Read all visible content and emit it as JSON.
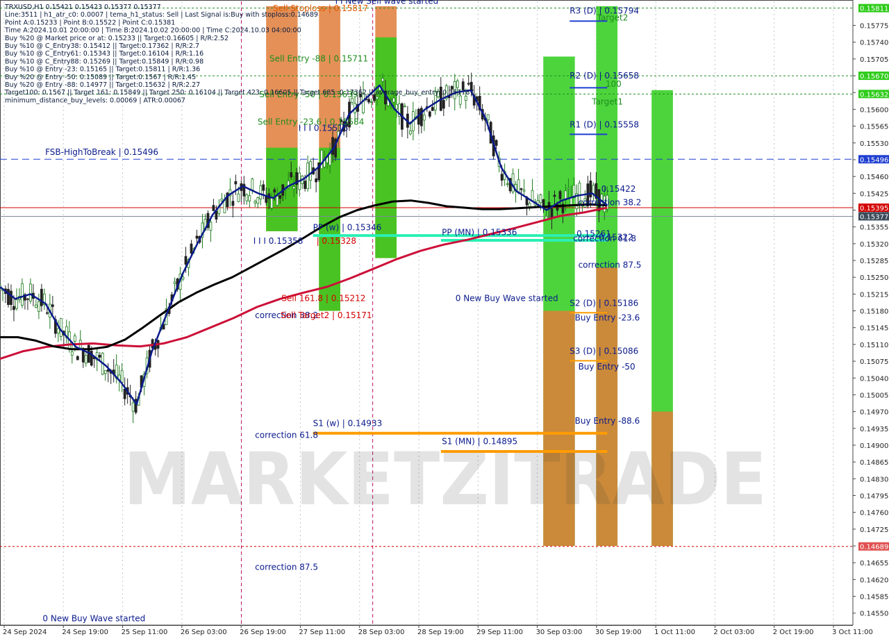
{
  "header_lines": [
    "TRXUSD,H1  0.15421 0.15423 0.15377 0.15377",
    "Line:3511 | h1_atr_c0: 0.0007 | tema_h1_status: Sell | Last Signal is:Buy with stoploss:0.14689",
    "Point A:0.15233 | Point B:0.15522 | Point C:0.15381",
    "Time A:2024.10.01 20:00:00 | Time B:2024.10.02 20:00:00 | Time C:2024.10.03 04:00:00",
    "Buy %20 @ Market price or at: 0.15233 || Target:0.16605 | R/R:2.52",
    "Buy %10 @ C_Entry38: 0.15412 || Target:0.17362 | R/R:2.7",
    "Buy %10 @ C_Entry61: 0.15343 || Target:0.16104 | R/R:1.16",
    "Buy %10 @ C_Entry88: 0.15269 || Target:0.15849 | R/R:0.98",
    "Buy %10 @ Entry -23: 0.15165 || Target:0.15811 | R/R:1.36",
    "Buy %20 @ Entry -50: 0.15089 || Target:0.1567 | R/R:1.45",
    "Buy %20 @ Entry -88: 0.14977 || Target:0.15632 | R/R:2.27",
    "Target100: 0.1567 || Target 161: 0.15849 || Target 250: 0.16104 || Target 423: 0.16605 || Target 685: 0.17362 || average_buy_entry: 0.151787",
    "minimum_distance_buy_levels: 0.00069 | ATR:0.00067"
  ],
  "watermark": "MARKETZITRADE",
  "colors": {
    "background": "#ffffff",
    "grid": "#d8dde4",
    "bull_candle": "#1e7a1e",
    "bear_candle": "#222222",
    "price_axis_text": "#222222",
    "green_zone": "#2ecc1a",
    "orange_zone": "#e07d3a",
    "level_line": "#ff9c00",
    "pivot_line": "#2af0b4",
    "ma_fast": "#0a1a8c",
    "ma_slow": "#000000",
    "ma_mid": "#cc1038",
    "label_blue": "#0a1a8c",
    "accent_red": "#d40000"
  },
  "chart_data": {
    "type": "candlestick",
    "symbol": "TRXUSD",
    "timeframe": "H1",
    "ylim": [
      0.14525,
      0.15825
    ],
    "y_ticks": [
      "0.15775",
      "0.15740",
      "0.15705",
      "0.15670",
      "0.15635",
      "0.15600",
      "0.15565",
      "0.15530",
      "0.15495",
      "0.15460",
      "0.15425",
      "0.15390",
      "0.15355",
      "0.15320",
      "0.15285",
      "0.15250",
      "0.15215",
      "0.15180",
      "0.15145",
      "0.15110",
      "0.15075",
      "0.15040",
      "0.15005",
      "0.14970",
      "0.14935",
      "0.14900",
      "0.14865",
      "0.14830",
      "0.14795",
      "0.14760",
      "0.14725",
      "0.14690",
      "0.14655",
      "0.14620",
      "0.14585",
      "0.14550"
    ],
    "x_labels": [
      "24 Sep 2024",
      "24 Sep 19:00",
      "25 Sep 11:00",
      "26 Sep 03:00",
      "26 Sep 19:00",
      "27 Sep 11:00",
      "28 Sep 03:00",
      "28 Sep 19:00",
      "29 Sep 11:00",
      "30 Sep 03:00",
      "30 Sep 19:00",
      "1 Oct 11:00",
      "2 Oct 03:00",
      "2 Oct 19:00",
      "3 Oct 11:00"
    ],
    "price_tags": [
      {
        "value": 0.15811,
        "text": "0.15811",
        "color": "#2ecc1a"
      },
      {
        "value": 0.1567,
        "text": "0.15670",
        "color": "#2ecc1a"
      },
      {
        "value": 0.15632,
        "text": "0.15632",
        "color": "#2ecc1a"
      },
      {
        "value": 0.15496,
        "text": "0.15496",
        "color": "#1f3fd1"
      },
      {
        "value": 0.15395,
        "text": "0.15395",
        "color": "#d40000"
      },
      {
        "value": 0.15377,
        "text": "0.15377",
        "color": "#3a4a5a"
      },
      {
        "value": 0.14689,
        "text": "0.14689",
        "color": "#e05050"
      }
    ],
    "horizontal_lines": [
      {
        "value": 0.15811,
        "color": "#1e8c1e",
        "dash": "3,3"
      },
      {
        "value": 0.1567,
        "color": "#1e8c1e",
        "dash": "3,3"
      },
      {
        "value": 0.15632,
        "color": "#1e8c1e",
        "dash": "3,3"
      },
      {
        "value": 0.15496,
        "color": "#1f3fd1",
        "dash": "10,6"
      },
      {
        "value": 0.15395,
        "color": "#d40000",
        "dash": ""
      },
      {
        "value": 0.15377,
        "color": "#7a8a9a",
        "dash": ""
      },
      {
        "value": 0.14689,
        "color": "#d40000",
        "dash": "3,3"
      }
    ],
    "zones": [
      {
        "x_from": 0.312,
        "x_to": 0.349,
        "y_from": 0.15815,
        "y_to": 0.15346,
        "color": "#e07d3a"
      },
      {
        "x_from": 0.312,
        "x_to": 0.349,
        "y_from": 0.1552,
        "y_to": 0.15346,
        "color": "#2ecc1a"
      },
      {
        "x_from": 0.374,
        "x_to": 0.399,
        "y_from": 0.15815,
        "y_to": 0.1518,
        "color": "#e07d3a"
      },
      {
        "x_from": 0.374,
        "x_to": 0.399,
        "y_from": 0.1552,
        "y_to": 0.1518,
        "color": "#2ecc1a"
      },
      {
        "x_from": 0.44,
        "x_to": 0.465,
        "y_from": 0.15815,
        "y_to": 0.1529,
        "color": "#e07d3a"
      },
      {
        "x_from": 0.44,
        "x_to": 0.465,
        "y_from": 0.1575,
        "y_to": 0.1529,
        "color": "#2ecc1a"
      },
      {
        "x_from": 0.637,
        "x_to": 0.674,
        "y_from": 0.1571,
        "y_to": 0.1469,
        "color": "#2ecc1a"
      },
      {
        "x_from": 0.637,
        "x_to": 0.674,
        "y_from": 0.1518,
        "y_to": 0.1469,
        "color": "#e07d3a"
      },
      {
        "x_from": 0.699,
        "x_to": 0.724,
        "y_from": 0.15815,
        "y_to": 0.1469,
        "color": "#2ecc1a"
      },
      {
        "x_from": 0.699,
        "x_to": 0.724,
        "y_from": 0.1527,
        "y_to": 0.1469,
        "color": "#e07d3a"
      },
      {
        "x_from": 0.764,
        "x_to": 0.789,
        "y_from": 0.1564,
        "y_to": 0.1469,
        "color": "#2ecc1a"
      },
      {
        "x_from": 0.764,
        "x_to": 0.789,
        "y_from": 0.1497,
        "y_to": 0.1469,
        "color": "#e07d3a"
      }
    ],
    "level_segments": [
      {
        "x_from": 0.367,
        "x_to": 0.712,
        "value": 0.14925,
        "color": "#ff9c00",
        "width": 4
      },
      {
        "x_from": 0.517,
        "x_to": 0.712,
        "value": 0.14887,
        "color": "#ff9c00",
        "width": 4
      },
      {
        "x_from": 0.367,
        "x_to": 0.712,
        "value": 0.15337,
        "color": "#2af0b4",
        "width": 4
      },
      {
        "x_from": 0.517,
        "x_to": 0.712,
        "value": 0.15327,
        "color": "#2af0b4",
        "width": 4
      },
      {
        "x_from": 0.668,
        "x_to": 0.712,
        "value": 0.15784,
        "color": "#1f3fd1",
        "width": 2
      },
      {
        "x_from": 0.668,
        "x_to": 0.712,
        "value": 0.15645,
        "color": "#1f3fd1",
        "width": 2
      },
      {
        "x_from": 0.668,
        "x_to": 0.712,
        "value": 0.15548,
        "color": "#1f3fd1",
        "width": 2
      },
      {
        "x_from": 0.668,
        "x_to": 0.712,
        "value": 0.15176,
        "color": "#ff9c00",
        "width": 2
      },
      {
        "x_from": 0.668,
        "x_to": 0.712,
        "value": 0.15076,
        "color": "#ff9c00",
        "width": 2
      }
    ],
    "annotations": [
      {
        "text": "FSB-HighToBreak | 0.15496",
        "x": 0.053,
        "value": 0.15505,
        "color": "#0a1a8c"
      },
      {
        "text": "Sell Stoploss | 0.15817",
        "x": 0.32,
        "value": 0.15805,
        "color": "#e05a00"
      },
      {
        "text": "I I New Sell wave started",
        "x": 0.393,
        "value": 0.1582,
        "color": "#0a1a8c"
      },
      {
        "text": "Sell Entry -88 | 0.15711",
        "x": 0.316,
        "value": 0.157,
        "color": "#1e8c1e"
      },
      {
        "text": "Sell Entry -50 | 0.15639",
        "x": 0.304,
        "value": 0.15625,
        "color": "#1e8c1e"
      },
      {
        "text": "Sell Entry -23.6 | 0.15584",
        "x": 0.302,
        "value": 0.15568,
        "color": "#1e8c1e"
      },
      {
        "text": "I I I 0.15515",
        "x": 0.35,
        "value": 0.15555,
        "color": "#0a1a8c"
      },
      {
        "text": "PP (w) | 0.15346",
        "x": 0.367,
        "value": 0.15348,
        "color": "#0a1a8c"
      },
      {
        "text": "PP (MN) | 0.15336",
        "x": 0.518,
        "value": 0.15338,
        "color": "#0a1a8c"
      },
      {
        "text": "I I I 0.15358",
        "x": 0.297,
        "value": 0.1532,
        "color": "#0a1a8c"
      },
      {
        "text": "| 0.15328",
        "x": 0.371,
        "value": 0.1532,
        "color": "#d40000"
      },
      {
        "text": "Sell 161.8 | 0.15212",
        "x": 0.33,
        "value": 0.152,
        "color": "#d40000"
      },
      {
        "text": "correction 38.2",
        "x": 0.299,
        "value": 0.15165,
        "color": "#0a1a8c"
      },
      {
        "text": "Sell Target2 | 0.15171",
        "x": 0.329,
        "value": 0.15165,
        "color": "#d40000"
      },
      {
        "text": "0 New Buy Wave started",
        "x": 0.534,
        "value": 0.152,
        "color": "#0a1a8c"
      },
      {
        "text": "R3 (D) | 0.15794",
        "x": 0.668,
        "value": 0.158,
        "color": "#0a1a8c"
      },
      {
        "text": "Target2",
        "x": 0.7,
        "value": 0.15785,
        "color": "#1e8c1e"
      },
      {
        "text": "R2 (D) | 0.15658",
        "x": 0.668,
        "value": 0.15664,
        "color": "#0a1a8c"
      },
      {
        "text": "100",
        "x": 0.71,
        "value": 0.15647,
        "color": "#1e8c1e"
      },
      {
        "text": "Target1",
        "x": 0.694,
        "value": 0.1561,
        "color": "#1e8c1e"
      },
      {
        "text": "R1 (D) | 0.15558",
        "x": 0.668,
        "value": 0.15562,
        "color": "#0a1a8c"
      },
      {
        "text": "0.15422",
        "x": 0.705,
        "value": 0.15428,
        "color": "#0a1a8c"
      },
      {
        "text": "correction 38.2",
        "x": 0.678,
        "value": 0.154,
        "color": "#0a1a8c"
      },
      {
        "text": "0.15261",
        "x": 0.676,
        "value": 0.15335,
        "color": "#0a1a8c"
      },
      {
        "text": "correction 61.8",
        "x": 0.672,
        "value": 0.15325,
        "color": "#0a1a8c"
      },
      {
        "text": "0.15322",
        "x": 0.702,
        "value": 0.15328,
        "color": "#0a1a8c"
      },
      {
        "text": "correction 87.5",
        "x": 0.678,
        "value": 0.1527,
        "color": "#0a1a8c"
      },
      {
        "text": "S2 (D) | 0.15186",
        "x": 0.668,
        "value": 0.1519,
        "color": "#0a1a8c"
      },
      {
        "text": "Buy Entry -23.6",
        "x": 0.674,
        "value": 0.1516,
        "color": "#0a1a8c"
      },
      {
        "text": "S3 (D) | 0.15086",
        "x": 0.668,
        "value": 0.1509,
        "color": "#0a1a8c"
      },
      {
        "text": "Buy Entry -50",
        "x": 0.678,
        "value": 0.15058,
        "color": "#0a1a8c"
      },
      {
        "text": "Buy Entry -88.6",
        "x": 0.674,
        "value": 0.14945,
        "color": "#0a1a8c"
      },
      {
        "text": "S1 (w) | 0.14933",
        "x": 0.367,
        "value": 0.1494,
        "color": "#0a1a8c"
      },
      {
        "text": "S1 (MN) | 0.14895",
        "x": 0.518,
        "value": 0.14902,
        "color": "#0a1a8c"
      },
      {
        "text": "correction 61.8",
        "x": 0.299,
        "value": 0.14915,
        "color": "#0a1a8c"
      },
      {
        "text": "correction 87.5",
        "x": 0.299,
        "value": 0.1464,
        "color": "#0a1a8c"
      },
      {
        "text": "0 New Buy Wave started",
        "x": 0.05,
        "value": 0.14533,
        "color": "#0a1a8c"
      }
    ],
    "ma_fast": [
      0.1523,
      0.15205,
      0.15215,
      0.15195,
      0.1514,
      0.15105,
      0.1509,
      0.15065,
      0.1503,
      0.14985,
      0.15095,
      0.15175,
      0.15255,
      0.1532,
      0.1538,
      0.1542,
      0.1544,
      0.15425,
      0.15415,
      0.1544,
      0.15455,
      0.1548,
      0.1552,
      0.1559,
      0.1562,
      0.1565,
      0.156,
      0.1557,
      0.156,
      0.1562,
      0.15635,
      0.1564,
      0.1558,
      0.1548,
      0.1543,
      0.1541,
      0.1539,
      0.1541,
      0.1542,
      0.15425,
      0.154
    ],
    "ma_slow": [
      0.15125,
      0.15125,
      0.15118,
      0.15106,
      0.151,
      0.151,
      0.15105,
      0.1512,
      0.15145,
      0.15172,
      0.15198,
      0.15218,
      0.15235,
      0.1525,
      0.1527,
      0.1529,
      0.1531,
      0.15332,
      0.15355,
      0.15375,
      0.1539,
      0.154,
      0.15408,
      0.1541,
      0.15405,
      0.15398,
      0.15395,
      0.15392,
      0.15392,
      0.15394,
      0.15396,
      0.15398,
      0.154,
      0.15402,
      0.154
    ],
    "ma_mid": [
      0.1508,
      0.15096,
      0.15105,
      0.1511,
      0.15112,
      0.15108,
      0.15106,
      0.15112,
      0.15125,
      0.15145,
      0.15165,
      0.15188,
      0.15205,
      0.15218,
      0.1523,
      0.15248,
      0.15268,
      0.15288,
      0.15305,
      0.15318,
      0.15328,
      0.1534,
      0.15352,
      0.15365,
      0.15378,
      0.15385,
      0.15395
    ]
  }
}
